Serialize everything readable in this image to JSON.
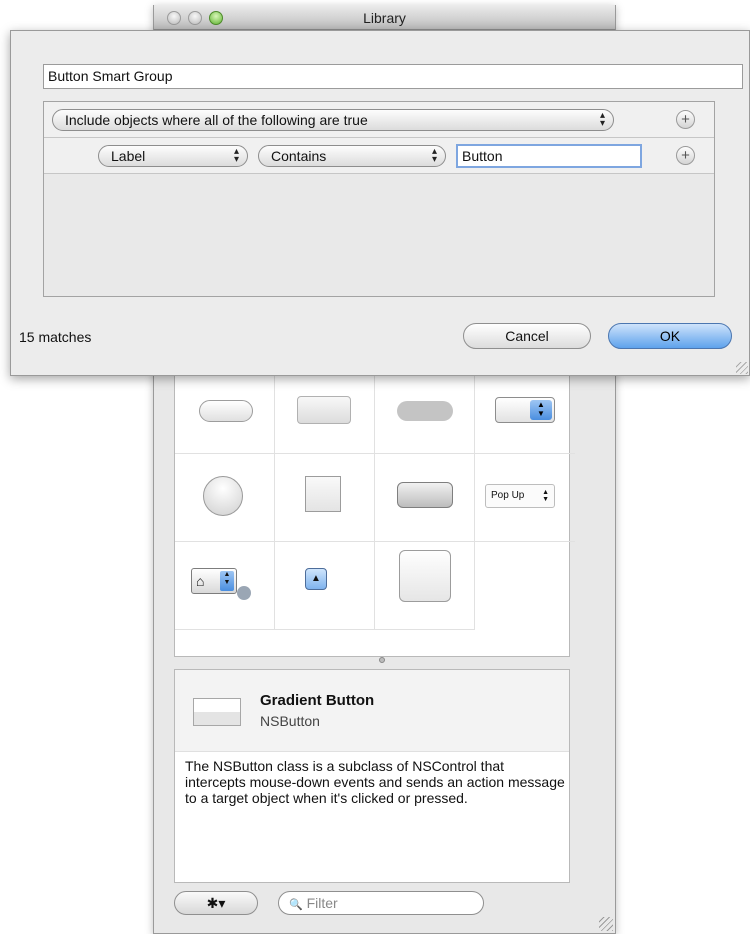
{
  "library": {
    "title": "Library",
    "detail": {
      "title": "Gradient Button",
      "class_name": "NSButton",
      "description": "The NSButton class is a subclass of NSControl that intercepts mouse-down events and sends an action message to a target object when it's clicked or pressed."
    },
    "popup_sample_label": "Pop Up",
    "filter_placeholder": "Filter",
    "gear_label": "✱▾",
    "filter_icon": "🔍"
  },
  "smart_group": {
    "name": "Button Smart Group",
    "predicate_header": "Include objects where all of the following are true",
    "rule": {
      "attribute": "Label",
      "operator": "Contains",
      "value": "Button"
    },
    "add_symbol": "+",
    "match_count": "15 matches",
    "cancel_label": "Cancel",
    "ok_label": "OK"
  },
  "colors": {
    "accent": "#5ea2ec",
    "focus_ring": "#7ea6e0",
    "zoom_button": "#5fb531"
  }
}
